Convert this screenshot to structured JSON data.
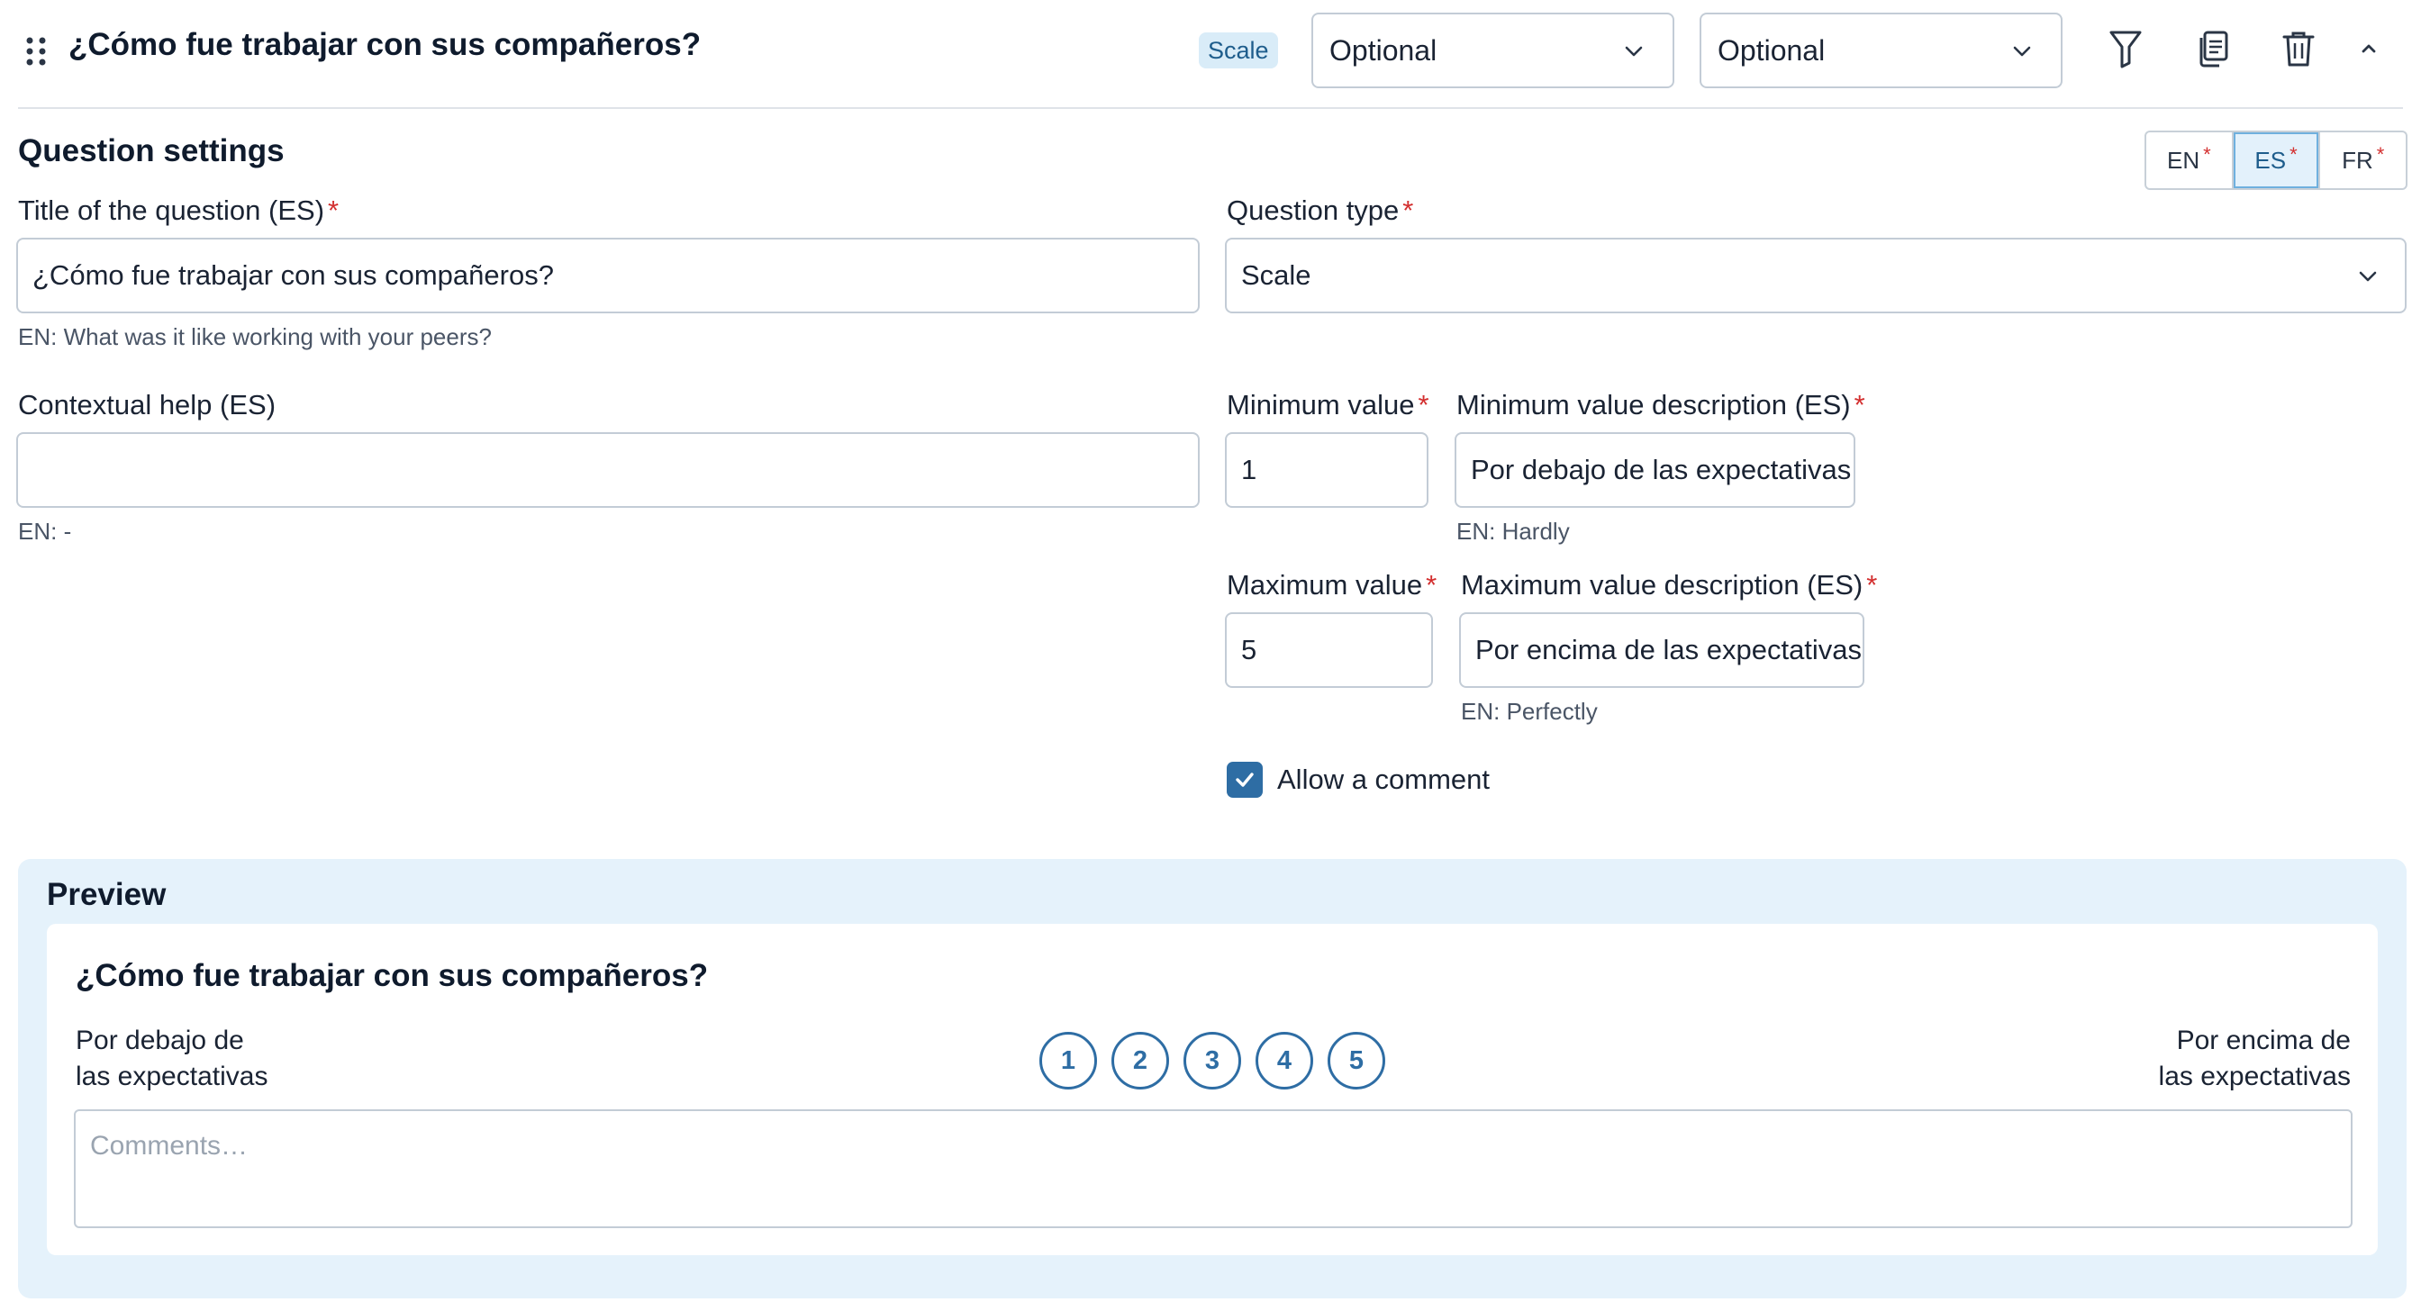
{
  "header": {
    "title": "¿Cómo fue trabajar con sus compañeros?",
    "type_tag": "Scale",
    "select_1": "Optional",
    "select_2": "Optional",
    "icons": [
      "drag-handle-icon",
      "filter-icon",
      "copy-icon",
      "trash-icon",
      "chevron-up-icon"
    ]
  },
  "settings": {
    "section_title": "Question settings",
    "languages": [
      {
        "code": "EN",
        "required_mark": "*"
      },
      {
        "code": "ES",
        "required_mark": "*",
        "active": true
      },
      {
        "code": "FR",
        "required_mark": "*"
      }
    ],
    "title_field": {
      "label": "Title of the question (ES)",
      "required_mark": "*",
      "value": "¿Cómo fue trabajar con sus compañeros?",
      "hint": "EN: What was it like working with your peers?"
    },
    "question_type": {
      "label": "Question type",
      "required_mark": "*",
      "value": "Scale"
    },
    "contextual_help": {
      "label": "Contextual help (ES)",
      "value": "",
      "hint": "EN: -"
    },
    "min_value": {
      "label": "Minimum value",
      "required_mark": "*",
      "value": "1"
    },
    "min_desc": {
      "label": "Minimum value description (ES)",
      "required_mark": "*",
      "value": "Por debajo de las expectativas",
      "hint": "EN: Hardly"
    },
    "max_value": {
      "label": "Maximum value",
      "required_mark": "*",
      "value": "5"
    },
    "max_desc": {
      "label": "Maximum value description (ES)",
      "required_mark": "*",
      "value": "Por encima de las expectativas",
      "hint": "EN: Perfectly"
    },
    "allow_comment": {
      "label": "Allow a comment",
      "checked": true
    }
  },
  "preview": {
    "title": "Preview",
    "question": "¿Cómo fue trabajar con sus compañeros?",
    "min_label_line1": "Por debajo de",
    "min_label_line2": "las expectativas",
    "max_label_line1": "Por encima de",
    "max_label_line2": "las expectativas",
    "scale": [
      "1",
      "2",
      "3",
      "4",
      "5"
    ],
    "comment_placeholder": "Comments…"
  },
  "colors": {
    "accent": "#2e6da4",
    "preview_bg": "#e5f2fb",
    "required": "#d32f2f"
  }
}
